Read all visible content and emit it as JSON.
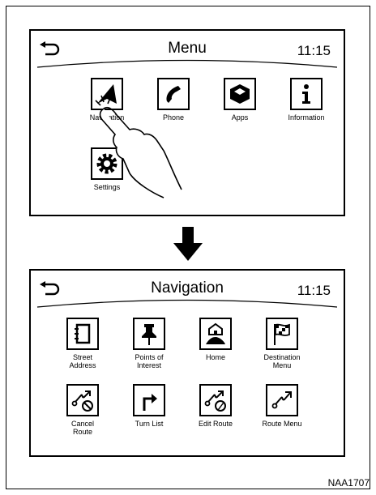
{
  "screens": {
    "menu": {
      "title": "Menu",
      "clock": "11:15",
      "items": [
        {
          "label": "Navigation",
          "icon": "navigation-arrow-icon"
        },
        {
          "label": "Phone",
          "icon": "phone-icon"
        },
        {
          "label": "Apps",
          "icon": "apps-cube-icon"
        },
        {
          "label": "Information",
          "icon": "info-icon"
        },
        {
          "label": "Settings",
          "icon": "gear-icon"
        }
      ]
    },
    "navigation": {
      "title": "Navigation",
      "clock": "11:15",
      "items": [
        {
          "label": "Street\nAddress",
          "icon": "address-book-icon"
        },
        {
          "label": "Points of\nInterest",
          "icon": "pushpin-icon"
        },
        {
          "label": "Home",
          "icon": "home-flag-icon"
        },
        {
          "label": "Destination\nMenu",
          "icon": "checkered-flag-icon"
        },
        {
          "label": "Cancel\nRoute",
          "icon": "cancel-route-icon"
        },
        {
          "label": "Turn List",
          "icon": "turn-arrow-icon"
        },
        {
          "label": "Edit Route",
          "icon": "edit-route-icon"
        },
        {
          "label": "Route Menu",
          "icon": "route-icon"
        }
      ]
    }
  },
  "figure_code": "NAA1707"
}
